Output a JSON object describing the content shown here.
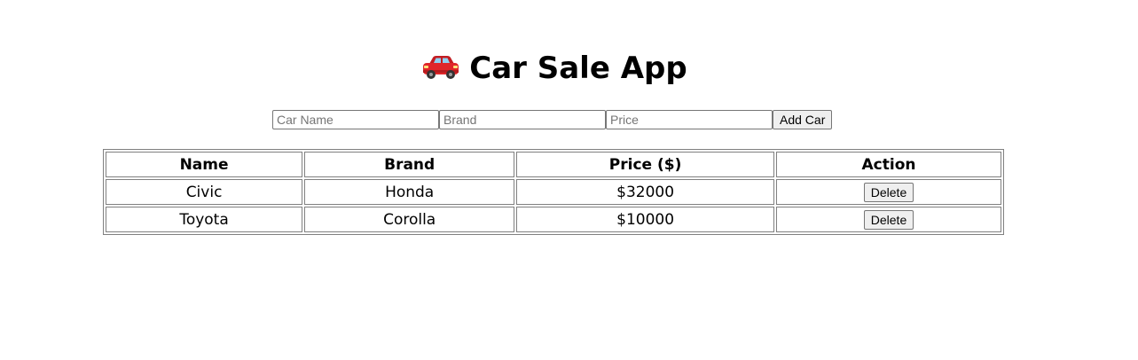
{
  "header": {
    "title_icon": "car-emoji",
    "title": "Car Sale App"
  },
  "form": {
    "name_placeholder": "Car Name",
    "brand_placeholder": "Brand",
    "price_placeholder": "Price",
    "name_value": "",
    "brand_value": "",
    "price_value": "",
    "add_button_label": "Add Car"
  },
  "table": {
    "headers": [
      "Name",
      "Brand",
      "Price ($)",
      "Action"
    ],
    "rows": [
      {
        "name": "Civic",
        "brand": "Honda",
        "price": "$32000",
        "action_label": "Delete"
      },
      {
        "name": "Toyota",
        "brand": "Corolla",
        "price": "$10000",
        "action_label": "Delete"
      }
    ]
  },
  "colors": {
    "car_body": "#e0262a",
    "car_window": "#8fd0f0",
    "border": "#808080"
  }
}
